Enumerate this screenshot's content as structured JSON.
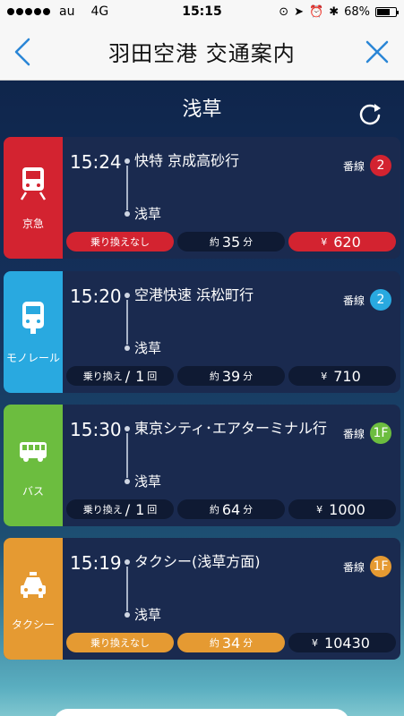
{
  "status_bar": {
    "carrier": "au",
    "network": "4G",
    "time": "15:15",
    "battery": "68%",
    "battery_fraction": 0.68
  },
  "nav": {
    "title": "羽田空港 交通案内"
  },
  "destination": "浅草",
  "platform_label": "番線",
  "routes": [
    {
      "mode": "京急",
      "color": "#d32330",
      "time": "15:24",
      "train": "快特 京成高砂行",
      "stop": "浅草",
      "platform": "2",
      "platform_color": "#d32330",
      "transfer_text": "乗り換えなし",
      "transfer_prefix": "",
      "transfer_count": "",
      "transfer_suffix": "",
      "transfer_highlight": "#d32330",
      "duration_prefix": "約",
      "duration": "35",
      "duration_suffix": "分",
      "duration_highlight": "",
      "fare_prefix": "¥",
      "fare": "620",
      "fare_highlight": "#d32330"
    },
    {
      "mode": "モノレール",
      "color": "#29a9e0",
      "time": "15:20",
      "train": "空港快速 浜松町行",
      "stop": "浅草",
      "platform": "2",
      "platform_color": "#29a9e0",
      "transfer_text": "",
      "transfer_prefix": "乗り換え",
      "transfer_count": "1",
      "transfer_suffix": "回",
      "transfer_highlight": "",
      "duration_prefix": "約",
      "duration": "39",
      "duration_suffix": "分",
      "duration_highlight": "",
      "fare_prefix": "¥",
      "fare": "710",
      "fare_highlight": ""
    },
    {
      "mode": "バス",
      "color": "#6cbd3f",
      "time": "15:30",
      "train": "東京シティ･エアターミナル行",
      "stop": "浅草",
      "platform": "1F",
      "platform_color": "#6cbd3f",
      "transfer_text": "",
      "transfer_prefix": "乗り換え",
      "transfer_count": "1",
      "transfer_suffix": "回",
      "transfer_highlight": "",
      "duration_prefix": "約",
      "duration": "64",
      "duration_suffix": "分",
      "duration_highlight": "",
      "fare_prefix": "¥",
      "fare": "1000",
      "fare_highlight": ""
    },
    {
      "mode": "タクシー",
      "color": "#e59a32",
      "time": "15:19",
      "train": "タクシー(浅草方面)",
      "stop": "浅草",
      "platform": "1F",
      "platform_color": "#e59a32",
      "transfer_text": "乗り換えなし",
      "transfer_prefix": "",
      "transfer_count": "",
      "transfer_suffix": "",
      "transfer_highlight": "#e59a32",
      "duration_prefix": "約",
      "duration": "34",
      "duration_suffix": "分",
      "duration_highlight": "#e59a32",
      "fare_prefix": "¥",
      "fare": "10430",
      "fare_highlight": ""
    }
  ]
}
